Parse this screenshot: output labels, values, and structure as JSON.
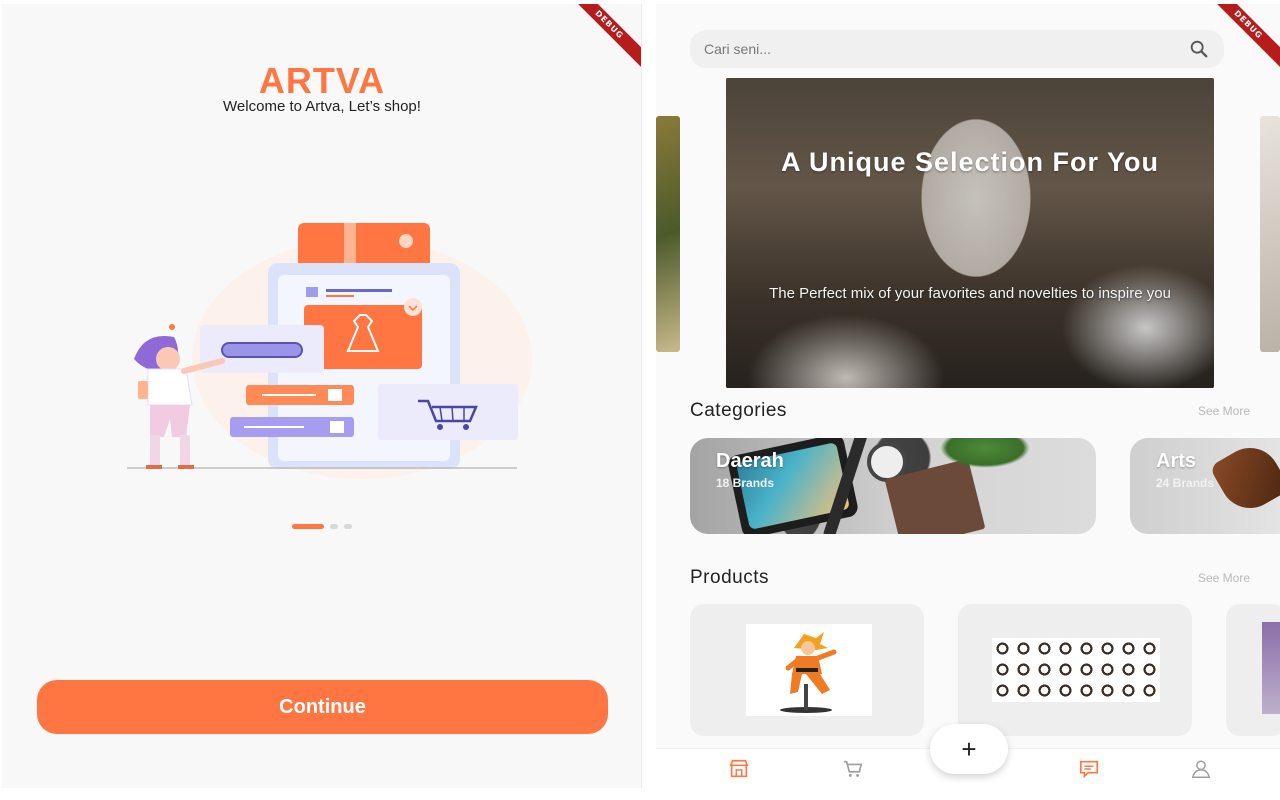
{
  "onboarding": {
    "brand": "ARTVA",
    "tagline": "Welcome to Artva, Let’s shop!",
    "pager": {
      "count": 3,
      "active_index": 0
    },
    "continue_label": "Continue",
    "debug_label": "DEBUG"
  },
  "home": {
    "debug_label": "DEBUG",
    "search": {
      "placeholder": "Cari seni..."
    },
    "banner": {
      "title": "A Unique Selection For You",
      "subtitle": "The Perfect mix of your favorites and novelties to inspire you"
    },
    "categories": {
      "title": "Categories",
      "see_more": "See More",
      "items": [
        {
          "name": "Daerah",
          "count": "18 Brands"
        },
        {
          "name": "Arts",
          "count": "24 Brands"
        }
      ]
    },
    "products": {
      "title": "Products",
      "see_more": "See More"
    },
    "fab_label": "+",
    "nav": {
      "active_color": "#ff7643",
      "items": [
        "shop-icon",
        "cart-icon",
        "chat-icon",
        "user-icon"
      ]
    }
  },
  "colors": {
    "accent": "#ff7643",
    "debug": "#b71c1c"
  }
}
